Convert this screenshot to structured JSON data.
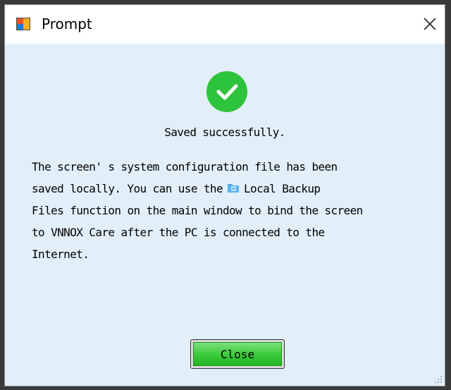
{
  "window": {
    "title": "Prompt"
  },
  "dialog": {
    "status_text": "Saved successfully.",
    "message_lines": [
      "The screen' s system configuration file has been",
      "saved locally. You can use the",
      "Local Backup",
      "Files function on the main window to bind the screen",
      "to VNNOX Care after the PC is connected to the",
      "Internet."
    ],
    "close_label": "Close"
  },
  "icons": {
    "app": "app-window-icon",
    "close": "close-icon",
    "success": "checkmark-circle-icon",
    "folder": "local-backup-folder-icon",
    "grip": "resize-grip-icon"
  },
  "colors": {
    "content_bg": "#e2eff9",
    "success_green": "#2ec33c",
    "button_green": "#3ecb3e"
  }
}
